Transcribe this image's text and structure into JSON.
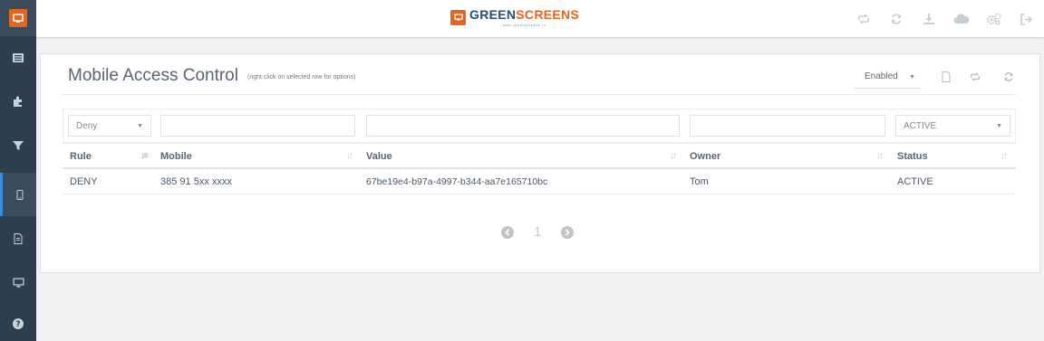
{
  "brand": {
    "name_part1": "GREEN",
    "name_part2": "SCREENS",
    "tagline": "www.greenscreens.io"
  },
  "sidebar": {
    "items": [
      {
        "icon": "list-icon"
      },
      {
        "icon": "puzzle-icon"
      },
      {
        "icon": "filter-icon"
      },
      {
        "icon": "mobile-icon",
        "active": true
      },
      {
        "icon": "document-icon"
      },
      {
        "icon": "monitor-icon"
      },
      {
        "icon": "help-icon"
      }
    ]
  },
  "topbar": {
    "icons": [
      "sync-icon",
      "refresh-icon",
      "download-icon",
      "cloud-icon",
      "settings-icon",
      "logout-icon"
    ]
  },
  "panel": {
    "title": "Mobile Access Control",
    "subtitle": "(right click on selected row for options)",
    "status_select": "Enabled",
    "icons": [
      "new-document-icon",
      "sync-icon",
      "refresh-icon"
    ]
  },
  "filters": {
    "rule": "Deny",
    "mobile": "",
    "value": "",
    "owner": "",
    "status": "ACTIVE"
  },
  "table": {
    "columns": [
      "Rule",
      "Mobile",
      "Value",
      "Owner",
      "Status"
    ],
    "rows": [
      {
        "rule": "DENY",
        "mobile": "385 91 5xx xxxx",
        "value": "67be19e4-b97a-4997-b344-aa7e165710bc",
        "owner": "Tom",
        "status": "ACTIVE"
      }
    ]
  },
  "pager": {
    "current_page": "1"
  },
  "colors": {
    "accent": "#e8641d",
    "sidebar": "#2d3e4f",
    "active_border": "#3a8fd6"
  }
}
